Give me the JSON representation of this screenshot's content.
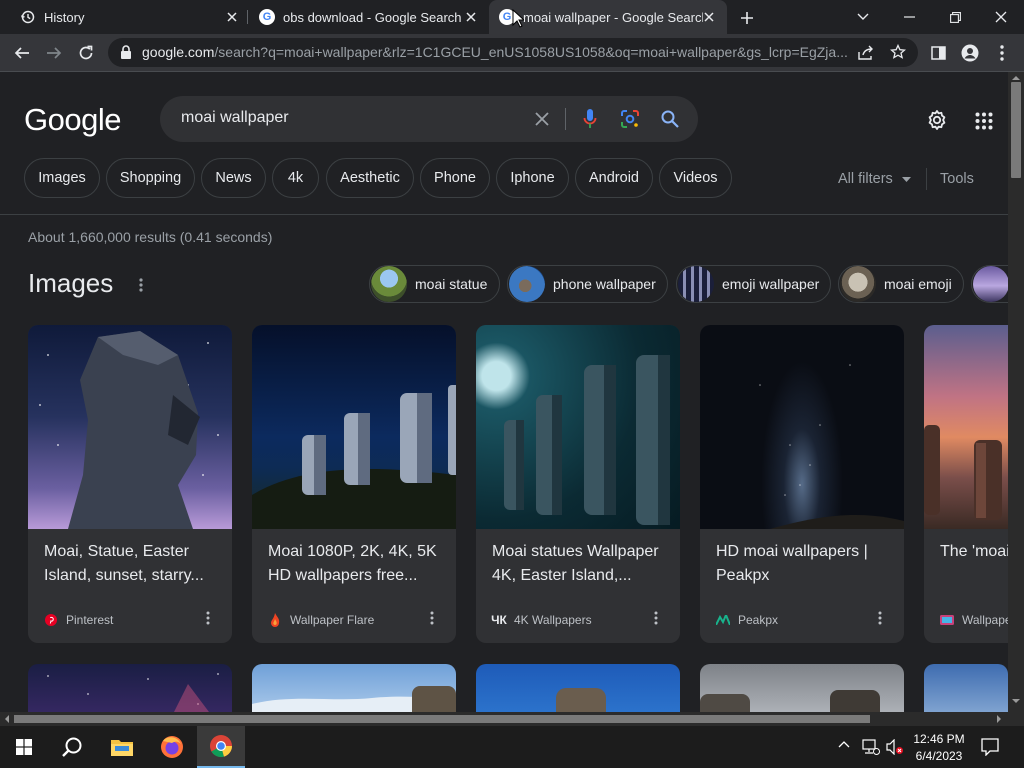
{
  "browser": {
    "tabs": [
      {
        "title": "History"
      },
      {
        "title": "obs download - Google Search"
      },
      {
        "title": "moai wallpaper - Google Search"
      }
    ],
    "url": {
      "domain": "google.com",
      "path": "/search?q=moai+wallpaper&rlz=1C1GCEU_enUS1058US1058&oq=moai+wallpaper&gs_lcrp=EgZja..."
    }
  },
  "search": {
    "logo": "Google",
    "query": "moai wallpaper",
    "chips": [
      "Images",
      "Shopping",
      "News",
      "4k",
      "Aesthetic",
      "Phone",
      "Iphone",
      "Android",
      "Videos"
    ],
    "all_filters": "All filters",
    "tools": "Tools",
    "result_stats": "About 1,660,000 results (0.41 seconds)"
  },
  "images": {
    "heading": "Images",
    "related": [
      "moai statue",
      "phone wallpaper",
      "emoji wallpaper",
      "moai emoji"
    ],
    "results": [
      {
        "title": "Moai, Statue, Easter Island, sunset, starry...",
        "source": "Pinterest"
      },
      {
        "title": "Moai 1080P, 2K, 4K, 5K HD wallpapers free...",
        "source": "Wallpaper Flare"
      },
      {
        "title": "Moai statues Wallpaper 4K, Easter Island,...",
        "source": "4K Wallpapers"
      },
      {
        "title": "HD moai wallpapers | Peakpx",
        "source": "Peakpx"
      },
      {
        "title": "The 'moai' Microsoft",
        "source": "Wallpape"
      }
    ]
  },
  "taskbar": {
    "time": "12:46 PM",
    "date": "6/4/2023"
  },
  "colors": {
    "accent_blue": "#8ab4f8",
    "page_bg": "#202124",
    "card_bg": "#303134"
  }
}
